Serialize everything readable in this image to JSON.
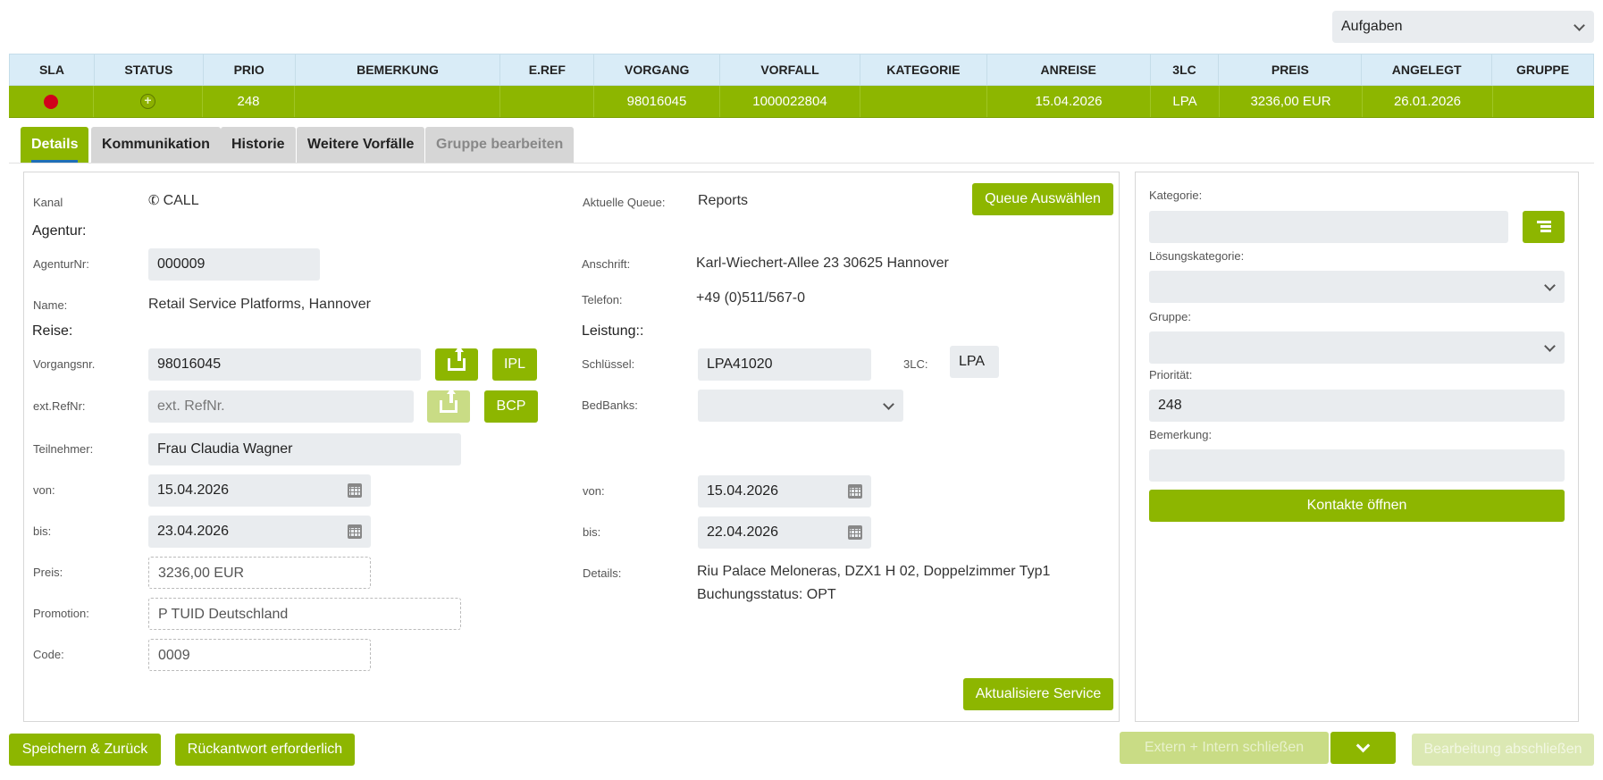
{
  "top_select": {
    "value": "Aufgaben"
  },
  "table": {
    "headers": [
      "SLA",
      "STATUS",
      "PRIO",
      "BEMERKUNG",
      "E.REF",
      "VORGANG",
      "VORFALL",
      "KATEGORIE",
      "ANREISE",
      "3LC",
      "PREIS",
      "ANGELEGT",
      "GRUPPE"
    ],
    "row": {
      "prio": "248",
      "bemerkung": "",
      "eref": "",
      "vorgang": "98016045",
      "vorfall": "1000022804",
      "kategorie": "",
      "anreise": "15.04.2026",
      "lc": "LPA",
      "preis": "3236,00 EUR",
      "angelegt": "26.01.2026",
      "gruppe": "",
      "status_icon": "plus-circle-icon",
      "sla_color": "#d0021b"
    }
  },
  "tabs": [
    "Details",
    "Kommunikation",
    "Historie",
    "Weitere Vorfälle",
    "Gruppe bearbeiten"
  ],
  "details": {
    "kanal_label": "Kanal",
    "kanal_value": "CALL",
    "agentur_section": "Agentur:",
    "agenturnr_label": "AgenturNr:",
    "agenturnr_value": "000009",
    "name_label": "Name:",
    "name_value": "Retail Service Platforms, Hannover",
    "reise_section": "Reise:",
    "vorgangsnr_label": "Vorgangsnr.",
    "vorgangsnr_value": "98016045",
    "ipl_button": "IPL",
    "extref_label": "ext.RefNr:",
    "extref_placeholder": "ext. RefNr.",
    "bcp_button": "BCP",
    "teilnehmer_label": "Teilnehmer:",
    "teilnehmer_value": "Frau Claudia Wagner",
    "von_label": "von:",
    "von_value": "15.04.2026",
    "bis_label": "bis:",
    "bis_value": "23.04.2026",
    "preis_label": "Preis:",
    "preis_value": "3236,00 EUR",
    "promotion_label": "Promotion:",
    "promotion_value": "P TUID Deutschland",
    "code_label": "Code:",
    "code_value": "0009",
    "queue_label": "Aktuelle Queue:",
    "queue_value": "Reports",
    "queue_button": "Queue Auswählen",
    "anschrift_label": "Anschrift:",
    "anschrift_value": "Karl-Wiechert-Allee 23 30625 Hannover",
    "telefon_label": "Telefon:",
    "telefon_value": "+49 (0)511/567-0",
    "leistung_section": "Leistung::",
    "schluessel_label": "Schlüssel:",
    "schluessel_value": "LPA41020",
    "lc_label": "3LC:",
    "lc_value": "LPA",
    "bedbanks_label": "BedBanks:",
    "bedbanks_value": "",
    "l_von_label": "von:",
    "l_von_value": "15.04.2026",
    "l_bis_label": "bis:",
    "l_bis_value": "22.04.2026",
    "details_label": "Details:",
    "details_value_1": "Riu Palace Meloneras, DZX1 H 02, Doppelzimmer Typ1",
    "details_value_2": "Buchungsstatus: OPT",
    "update_button": "Aktualisiere Service"
  },
  "side": {
    "kategorie_label": "Kategorie:",
    "kategorie_value": "",
    "loesung_label": "Lösungskategorie:",
    "loesung_value": "",
    "gruppe_label": "Gruppe:",
    "gruppe_value": "",
    "prio_label": "Priorität:",
    "prio_value": "248",
    "bemerkung_label": "Bemerkung:",
    "bemerkung_value": "",
    "kontakte_button": "Kontakte öffnen"
  },
  "footer": {
    "save_button": "Speichern & Zurück",
    "reply_button": "Rückantwort erforderlich",
    "close_button": "Extern + Intern schließen",
    "finish_button": "Bearbeitung abschließen"
  },
  "colors": {
    "accent": "#8db600",
    "header_bg": "#d9ecf7",
    "input_bg": "#e9ecef"
  }
}
